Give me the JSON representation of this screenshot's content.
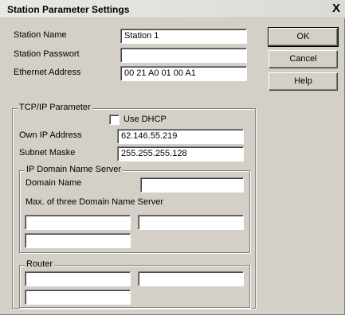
{
  "window": {
    "title": "Station Parameter Settings",
    "close_glyph": "X"
  },
  "station": {
    "name_label": "Station Name",
    "name_value": "Station 1",
    "password_label": "Station Passwort",
    "password_value": "",
    "ethernet_label": "Ethernet Address",
    "ethernet_value": "00 21 A0 01 00 A1"
  },
  "buttons": {
    "ok": "OK",
    "cancel": "Cancel",
    "help": "Help"
  },
  "tcpip": {
    "group_label": "TCP/IP Parameter",
    "use_dhcp_label": "Use DHCP",
    "use_dhcp_checked": false,
    "own_ip_label": "Own IP Address",
    "own_ip_value": "62.146.55.219",
    "subnet_label": "Subnet Maske",
    "subnet_value": "255.255.255.128"
  },
  "dns": {
    "group_label": "IP Domain Name Server",
    "domain_label": "Domain Name",
    "domain_value": "",
    "max_label": "Max. of three Domain Name Server",
    "server1": "",
    "server2": "",
    "server3": ""
  },
  "router": {
    "group_label": "Router",
    "router1": "",
    "router2": "",
    "router3": ""
  }
}
